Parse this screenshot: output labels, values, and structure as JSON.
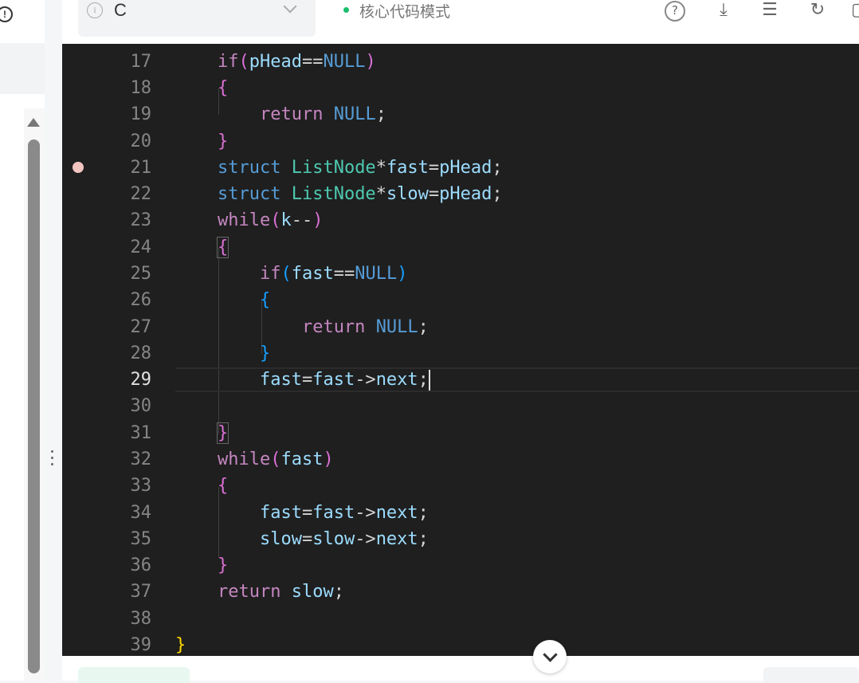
{
  "header": {
    "language": "C",
    "mode_label": "核心代码模式"
  },
  "editor": {
    "current_line": 29,
    "breakpoint_line": 21
  },
  "bottom": {
    "tab_active": "",
    "tabs": []
  },
  "colors": {
    "mode_dot": "#19be6b",
    "editor_bg": "#1f1f1f",
    "breakpoint": "#f3c5c1"
  }
}
